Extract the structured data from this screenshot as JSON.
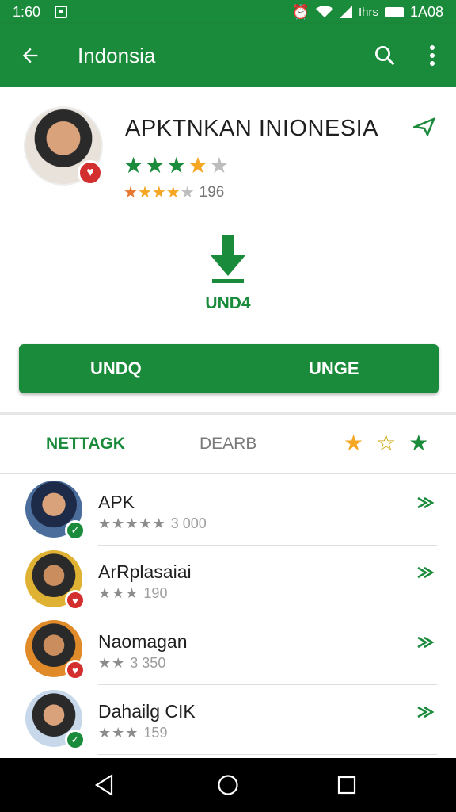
{
  "status": {
    "time_left": "1:60",
    "time_right": "1A08",
    "carrier": "Ihrs"
  },
  "appbar": {
    "title": "Indonsia",
    "back_icon": "arrow-back-icon",
    "search_icon": "search-icon",
    "more_icon": "more-vert-icon"
  },
  "app": {
    "title": "APKTNKAN INIONESIA",
    "rating_stars": "★★★★★",
    "small_stars": "★★★★★",
    "review_count": "196",
    "download_label": "UND4",
    "colors": {
      "accent": "#1a8a3b",
      "star_gold": "#f5a623",
      "star_gray": "#bdbdbd"
    }
  },
  "cta": {
    "left_label": "UNDQ",
    "right_label": "UNGE"
  },
  "tabs": {
    "tab_a": "NETTAGK",
    "tab_b": "DEARB",
    "icons": [
      "star-filled-gold-icon",
      "star-outline-icon",
      "star-filled-green-icon"
    ]
  },
  "list": [
    {
      "name": "APK",
      "stars": "★★★★★",
      "count": "3 000",
      "badge": "check",
      "bg": "#4a6d9c"
    },
    {
      "name": "ArRplasaiai",
      "stars": "★★★",
      "count": "190",
      "badge": "heart",
      "bg": "#e0b233"
    },
    {
      "name": "Naomagan",
      "stars": "★★",
      "count": "3 350",
      "badge": "heart",
      "bg": "#e08a2a"
    },
    {
      "name": "Dahailg CIK",
      "stars": "★★★",
      "count": "159",
      "badge": "check",
      "bg": "#6a8fb3"
    }
  ],
  "nav": {
    "back": "nav-back-icon",
    "home": "nav-home-icon",
    "recents": "nav-recents-icon"
  }
}
